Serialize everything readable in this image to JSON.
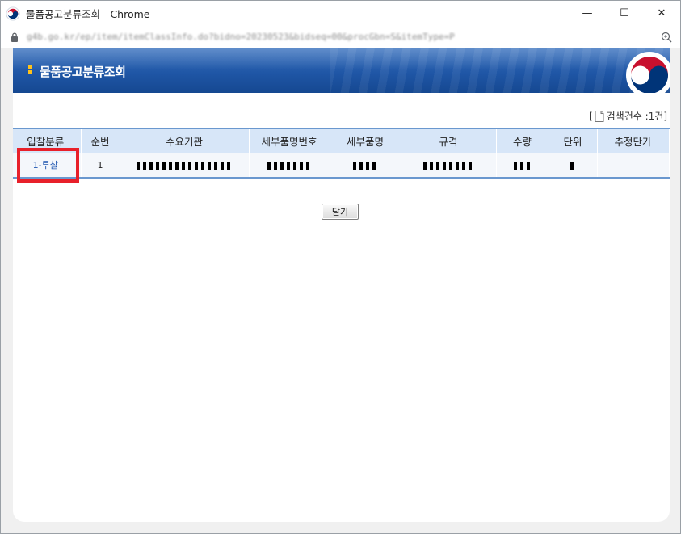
{
  "window": {
    "title": "물품공고분류조회 - Chrome",
    "minimize_label": "—",
    "maximize_label": "☐",
    "close_label": "✕",
    "icon": "korea-gov-emblem-icon"
  },
  "addressbar": {
    "url": "g4b.go.kr/ep/item/itemClassInfo.do?bidno=20230523&bidseq=00&procGbn=S&itemType=P",
    "lock_icon": "lock-icon",
    "zoom_icon": "zoom-icon"
  },
  "banner": {
    "title": "물품공고분류조회",
    "emblem": "korea-gov-emblem-icon",
    "accent_color": "#ffc21a",
    "background_color": "#1f56a6"
  },
  "count": {
    "open": "[",
    "label": "검색건수 :1건]"
  },
  "table": {
    "columns": [
      "입찰분류",
      "순번",
      "수요기관",
      "세부품명번호",
      "세부품명",
      "규격",
      "수량",
      "단위",
      "추정단가"
    ],
    "rows": [
      {
        "category": "1-투찰",
        "seq": "1",
        "demand_agency": "",
        "item_number": "",
        "item_name": "",
        "spec": "",
        "quantity": "",
        "unit": "",
        "estimated_price": ""
      }
    ]
  },
  "buttons": {
    "close": "닫기"
  },
  "highlight_color": "#e8202a"
}
